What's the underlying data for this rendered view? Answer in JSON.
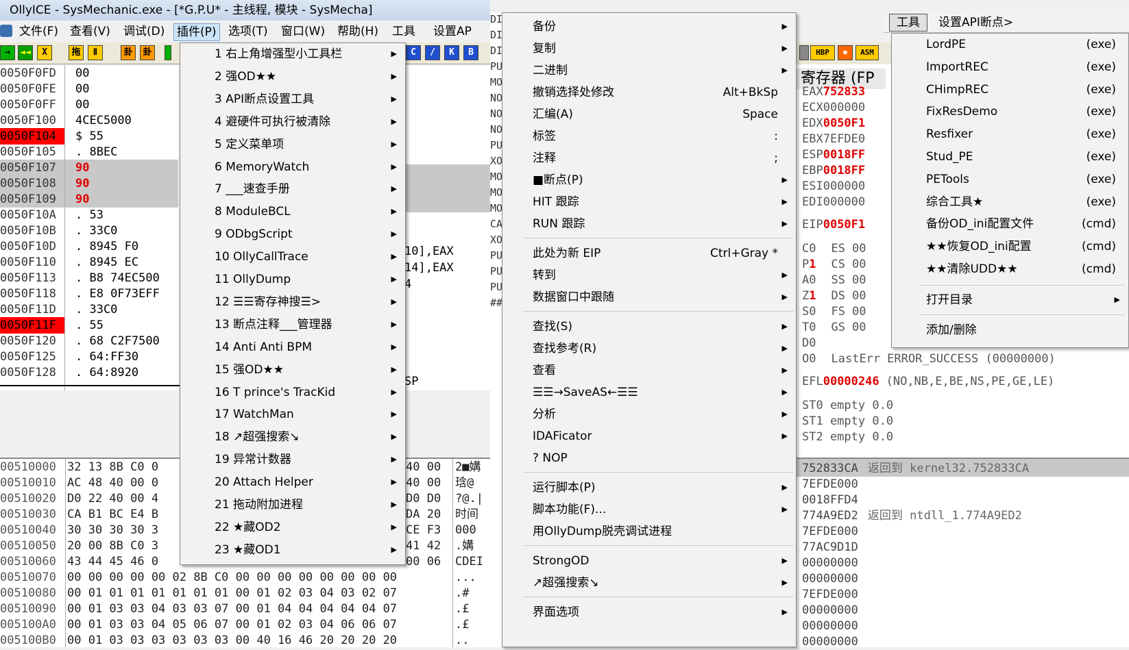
{
  "window": {
    "title": "OllyICE - SysMechanic.exe - [*G.P.U* -  主线程, 模块 - SysMecha]"
  },
  "menubar": {
    "items": [
      "文件(F)",
      "查看(V)",
      "调试(D)",
      "插件(P)",
      "选项(T)",
      "窗口(W)",
      "帮助(H)",
      "工具",
      "设置AP"
    ]
  },
  "toolbar": {
    "buttons": [
      "→",
      "◄◄",
      "X",
      "拖",
      "Ⅱ",
      "卦",
      "卦"
    ],
    "right_buttons": [
      "C",
      "/",
      "K",
      "B"
    ],
    "reg_buttons": [
      "HBP",
      "ASM"
    ]
  },
  "disasm": {
    "rows": [
      {
        "addr": "0050F0FD",
        "data": "00",
        "sel": false,
        "addr_red": false,
        "data_red": false
      },
      {
        "addr": "0050F0FE",
        "data": "00",
        "sel": false,
        "addr_red": false,
        "data_red": false
      },
      {
        "addr": "0050F0FF",
        "data": "00",
        "sel": false,
        "addr_red": false,
        "data_red": false
      },
      {
        "addr": "0050F100",
        "data": "4CEC5000",
        "sel": false,
        "addr_red": false,
        "data_red": false
      },
      {
        "addr": "0050F104",
        "data": "$ 55",
        "sel": false,
        "addr_red": true,
        "data_red": false
      },
      {
        "addr": "0050F105",
        "data": ". 8BEC",
        "sel": false,
        "addr_red": false,
        "data_red": false
      },
      {
        "addr": "0050F107",
        "data": "90",
        "sel": true,
        "addr_red": false,
        "data_red": true
      },
      {
        "addr": "0050F108",
        "data": "90",
        "sel": true,
        "addr_red": false,
        "data_red": true
      },
      {
        "addr": "0050F109",
        "data": "90",
        "sel": true,
        "addr_red": false,
        "data_red": true
      },
      {
        "addr": "0050F10A",
        "data": ". 53",
        "sel": false,
        "addr_red": false,
        "data_red": false
      },
      {
        "addr": "0050F10B",
        "data": ". 33C0",
        "sel": false,
        "addr_red": false,
        "data_red": false
      },
      {
        "addr": "0050F10D",
        "data": ". 8945 F0",
        "sel": false,
        "addr_red": false,
        "data_red": false
      },
      {
        "addr": "0050F110",
        "data": ". 8945 EC",
        "sel": false,
        "addr_red": false,
        "data_red": false
      },
      {
        "addr": "0050F113",
        "data": ". B8 74EC500",
        "sel": false,
        "addr_red": false,
        "data_red": false
      },
      {
        "addr": "0050F118",
        "data": ". E8 0F73EFF",
        "sel": false,
        "addr_red": false,
        "data_red": false
      },
      {
        "addr": "0050F11D",
        "data": ". 33C0",
        "sel": false,
        "addr_red": false,
        "data_red": false
      },
      {
        "addr": "0050F11F",
        "data": ". 55",
        "sel": false,
        "addr_red": true,
        "data_red": false
      },
      {
        "addr": "0050F120",
        "data": ". 68 C2F7500",
        "sel": false,
        "addr_red": false,
        "data_red": false
      },
      {
        "addr": "0050F125",
        "data": ". 64:FF30",
        "sel": false,
        "addr_red": false,
        "data_red": false
      },
      {
        "addr": "0050F128",
        "data": ". 64:8920",
        "sel": false,
        "addr_red": false,
        "data_red": false
      }
    ],
    "right_fragments": [
      "10],EAX",
      "14],EAX",
      "4",
      "SP"
    ]
  },
  "gutter_letters": [
    "DI",
    "DI",
    "DI",
    "PU",
    "MO",
    "NO",
    "NO",
    "NO",
    "PU",
    "XO",
    "MO",
    "MO",
    "MO",
    "CA",
    "XO",
    "PU",
    "PU",
    "PU",
    "##"
  ],
  "dump": {
    "rows": [
      {
        "addr": "00510000",
        "hex": "32 13 8B C0 0",
        "hex2": "40 00",
        "ascii": "2■媾"
      },
      {
        "addr": "00510010",
        "hex": "AC 48 40 00 0",
        "hex2": "40 00",
        "ascii": "琀@"
      },
      {
        "addr": "00510020",
        "hex": "D0 22 40 00 4",
        "hex2": "D0 D0",
        "ascii": "?@.|"
      },
      {
        "addr": "00510030",
        "hex": "CA B1 BC E4 B",
        "hex2": "DA 20",
        "ascii": "时间"
      },
      {
        "addr": "00510040",
        "hex": "30 30 30 30 3",
        "hex2": "CE F3",
        "ascii": "000"
      },
      {
        "addr": "00510050",
        "hex": "20 00 8B C0 3",
        "hex2": "41 42",
        "ascii": ".媾"
      },
      {
        "addr": "00510060",
        "hex": "43 44 45 46 0",
        "hex2": "00 06",
        "ascii": "CDEI"
      },
      {
        "addr": "00510070",
        "hex": "00 00 00 00 00 02 8B C0 00 00 00 00 00 00 00 00",
        "hex2": "",
        "ascii": "..."
      },
      {
        "addr": "00510080",
        "hex": "00 01 01 01 01 01 01 01 00 01 02 03 04 03 02 07",
        "hex2": "",
        "ascii": ".#"
      },
      {
        "addr": "00510090",
        "hex": "00 01 03 03 04 03 03 07 00 01 04 04 04 04 04 07",
        "hex2": "",
        "ascii": ".£"
      },
      {
        "addr": "005100A0",
        "hex": "00 01 03 03 04 05 06 07 00 01 02 03 04 06 06 07",
        "hex2": "",
        "ascii": ".£"
      },
      {
        "addr": "005100B0",
        "hex": "00 01 03 03 03 03 03 03 00 40 16 46 20 20 20 20",
        "hex2": "",
        "ascii": ".."
      }
    ]
  },
  "plugin_menu": {
    "items": [
      "1 右上角增强型小工具栏",
      "2 强OD★★",
      "3 API断点设置工具",
      "4 避硬件可执行被清除",
      "5 定义菜单项",
      "6 MemoryWatch",
      "7 ___速查手册",
      "8 ModuleBCL",
      "9 ODbgScript",
      "10 OllyCallTrace",
      "11 OllyDump",
      "12 ☰☰寄存神搜☰>",
      "13 断点注释___管理器",
      "14 Anti Anti BPM",
      "15 强OD★★",
      "16 T prince's TracKid",
      "17 WatchMan",
      "18 ↗超强搜索↘",
      "19 异常计数器",
      "20 Attach Helper",
      "21 拖动附加进程",
      "22 ★藏OD2",
      "23 ★藏OD1"
    ]
  },
  "context_menu": {
    "groups": [
      [
        {
          "label": "备份",
          "shortcut": "",
          "arrow": true
        },
        {
          "label": "复制",
          "shortcut": "",
          "arrow": true
        },
        {
          "label": "二进制",
          "shortcut": "",
          "arrow": true
        },
        {
          "label": "撤销选择处修改",
          "shortcut": "Alt+BkSp",
          "arrow": false
        },
        {
          "label": "汇编(A)",
          "shortcut": "Space",
          "arrow": false
        },
        {
          "label": "标签",
          "shortcut": ":",
          "arrow": false
        },
        {
          "label": "注释",
          "shortcut": ";",
          "arrow": false
        },
        {
          "label": "■断点(P)",
          "shortcut": "",
          "arrow": true
        },
        {
          "label": "HIT 跟踪",
          "shortcut": "",
          "arrow": true
        },
        {
          "label": "RUN 跟踪",
          "shortcut": "",
          "arrow": true
        }
      ],
      [
        {
          "label": "此处为新 EIP",
          "shortcut": "Ctrl+Gray *",
          "arrow": false
        },
        {
          "label": "转到",
          "shortcut": "",
          "arrow": true
        },
        {
          "label": "数据窗口中跟随",
          "shortcut": "",
          "arrow": true
        }
      ],
      [
        {
          "label": "查找(S)",
          "shortcut": "",
          "arrow": true
        },
        {
          "label": "查找参考(R)",
          "shortcut": "",
          "arrow": true
        },
        {
          "label": "查看",
          "shortcut": "",
          "arrow": true
        },
        {
          "label": "☰☰→SaveAS←☰☰",
          "shortcut": "",
          "arrow": true
        },
        {
          "label": "分析",
          "shortcut": "",
          "arrow": true
        },
        {
          "label": "IDAFicator",
          "shortcut": "",
          "arrow": true
        },
        {
          "label": "? NOP",
          "shortcut": "",
          "arrow": false
        }
      ],
      [
        {
          "label": "运行脚本(P)",
          "shortcut": "",
          "arrow": true
        },
        {
          "label": "脚本功能(F)...",
          "shortcut": "",
          "arrow": true
        },
        {
          "label": "用OllyDump脱壳调试进程",
          "shortcut": "",
          "arrow": false
        }
      ],
      [
        {
          "label": "StrongOD",
          "shortcut": "",
          "arrow": true
        },
        {
          "label": "↗超强搜索↘",
          "shortcut": "",
          "arrow": true
        }
      ],
      [
        {
          "label": "界面选项",
          "shortcut": "",
          "arrow": true
        }
      ]
    ]
  },
  "tools_header": {
    "tab": "工具",
    "api": "设置API断点>"
  },
  "tools_menu": {
    "items": [
      {
        "label": "LordPE",
        "type": "(exe)"
      },
      {
        "label": "ImportREC",
        "type": "(exe)"
      },
      {
        "label": "CHimpREC",
        "type": "(exe)"
      },
      {
        "label": "FixResDemo",
        "type": "(exe)"
      },
      {
        "label": "Resfixer",
        "type": "(exe)"
      },
      {
        "label": "Stud_PE",
        "type": "(exe)"
      },
      {
        "label": "PETools",
        "type": "(exe)"
      },
      {
        "label": "综合工具★",
        "type": "(exe)"
      },
      {
        "label": "备份OD_ini配置文件",
        "type": "(cmd)"
      },
      {
        "label": "★★恢复OD_ini配置",
        "type": "(cmd)"
      },
      {
        "label": "★★清除UDD★★",
        "type": "(cmd)"
      }
    ],
    "open_dir": "打开目录",
    "add_remove": "添加/删除"
  },
  "registers": {
    "title": "寄存器 (FP",
    "rows": [
      {
        "name": "EAX",
        "value": "752833",
        "red": true
      },
      {
        "name": "ECX",
        "value": "000000",
        "red": false
      },
      {
        "name": "EDX",
        "value": "0050F1",
        "red": true
      },
      {
        "name": "EBX",
        "value": "7EFDE0",
        "red": false
      },
      {
        "name": "ESP",
        "value": "0018FF",
        "red": true
      },
      {
        "name": "EBP",
        "value": "0018FF",
        "red": true
      },
      {
        "name": "ESI",
        "value": "000000",
        "red": false
      },
      {
        "name": "EDI",
        "value": "000000",
        "red": false
      }
    ],
    "eip": {
      "name": "EIP",
      "value": "0050F1"
    },
    "flags": [
      {
        "f": "C",
        "v": "0",
        "seg": "ES",
        "sv": "00",
        "red": false
      },
      {
        "f": "P",
        "v": "1",
        "seg": "CS",
        "sv": "00",
        "red": true
      },
      {
        "f": "A",
        "v": "0",
        "seg": "SS",
        "sv": "00",
        "red": false
      },
      {
        "f": "Z",
        "v": "1",
        "seg": "DS",
        "sv": "00",
        "red": true
      },
      {
        "f": "S",
        "v": "0",
        "seg": "FS",
        "sv": "00",
        "red": false
      },
      {
        "f": "T",
        "v": "0",
        "seg": "GS",
        "sv": "00",
        "red": false
      },
      {
        "f": "D",
        "v": "0",
        "seg": "",
        "sv": "",
        "red": false
      },
      {
        "f": "O",
        "v": "0",
        "seg": "LastErr",
        "sv": "ERROR_SUCCESS (00000000)",
        "red": false
      }
    ],
    "efl": {
      "name": "EFL",
      "value": "00000246",
      "desc": "(NO,NB,E,BE,NS,PE,GE,LE)"
    },
    "st": [
      "ST0 empty 0.0",
      "ST1 empty 0.0",
      "ST2 empty 0.0"
    ]
  },
  "stack": {
    "rows": [
      {
        "addr": "752833CA",
        "comment": "返回到 kernel32.752833CA",
        "sel": true
      },
      {
        "addr": "7EFDE000",
        "comment": "",
        "sel": false
      },
      {
        "addr": "0018FFD4",
        "comment": "",
        "sel": false
      },
      {
        "addr": "774A9ED2",
        "comment": "返回到 ntdll_1.774A9ED2",
        "sel": false
      },
      {
        "addr": "7EFDE000",
        "comment": "",
        "sel": false
      },
      {
        "addr": "77AC9D1D",
        "comment": "",
        "sel": false
      },
      {
        "addr": "00000000",
        "comment": "",
        "sel": false
      },
      {
        "addr": "00000000",
        "comment": "",
        "sel": false
      },
      {
        "addr": "7EFDE000",
        "comment": "",
        "sel": false
      },
      {
        "addr": "00000000",
        "comment": "",
        "sel": false
      },
      {
        "addr": "00000000",
        "comment": "",
        "sel": false
      },
      {
        "addr": "00000000",
        "comment": "",
        "sel": false
      }
    ]
  }
}
